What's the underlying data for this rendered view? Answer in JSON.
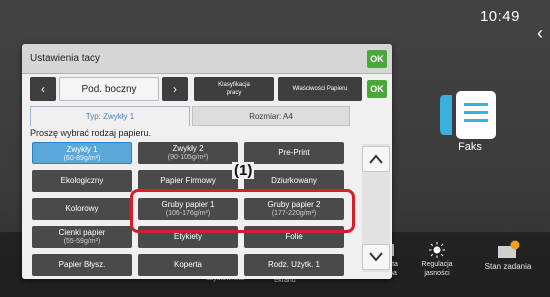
{
  "status_bar": {
    "time": "10:49"
  },
  "home_tiles": {
    "fax_label": "Faks"
  },
  "bottom_bar": [
    {
      "label_line1": "użytkownika",
      "label_line2": ""
    },
    {
      "label_line1": "ekranu",
      "label_line2": ""
    },
    {
      "label_line1": "kowita",
      "label_line2": "liczba"
    },
    {
      "label_line1": "Regulacja",
      "label_line2": "jasności"
    },
    {
      "label_line1": "Stan zadania",
      "label_line2": ""
    }
  ],
  "dialog": {
    "title": "Ustawienia tacy",
    "ok_label": "OK",
    "tray_label": "Pod. boczny",
    "classify_line1": "Klasyfikacja",
    "classify_line2": "pracy",
    "paper_props": "Właściwości Papieru",
    "ok2_label": "OK",
    "tab_type": "Typ: Zwykły 1",
    "tab_size": "Rozmiar: A4",
    "prompt": "Proszę wybrać rodzaj papieru."
  },
  "paper_types": [
    {
      "name": "Zwykły 1",
      "weight": "(60-89g/m²)",
      "selected": true
    },
    {
      "name": "Zwykły 2",
      "weight": "(90-105g/m²)",
      "selected": false
    },
    {
      "name": "Pre-Print",
      "weight": "",
      "selected": false
    },
    {
      "name": "Ekologiczny",
      "weight": "",
      "selected": false
    },
    {
      "name": "Papier Firmowy",
      "weight": "",
      "selected": false
    },
    {
      "name": "Dziurkowany",
      "weight": "",
      "selected": false
    },
    {
      "name": "Kolorowy",
      "weight": "",
      "selected": false
    },
    {
      "name": "Gruby papier 1",
      "weight": "(106-176g/m²)",
      "selected": false
    },
    {
      "name": "Gruby papier 2",
      "weight": "(177-220g/m²)",
      "selected": false
    },
    {
      "name": "Cienki papier",
      "weight": "(55-59g/m²)",
      "selected": false
    },
    {
      "name": "Etykiety",
      "weight": "",
      "selected": false
    },
    {
      "name": "Folie",
      "weight": "",
      "selected": false
    },
    {
      "name": "Papier Błysz.",
      "weight": "",
      "selected": false
    },
    {
      "name": "Koperta",
      "weight": "",
      "selected": false
    },
    {
      "name": "Rodz. Użytk. 1",
      "weight": "",
      "selected": false
    }
  ],
  "annotation": {
    "label": "(1)"
  },
  "colors": {
    "ok_green": "#4aa83a",
    "selected_blue": "#5aa7da",
    "callout_red": "#d81e28",
    "button_dark": "#4a4a4a"
  }
}
